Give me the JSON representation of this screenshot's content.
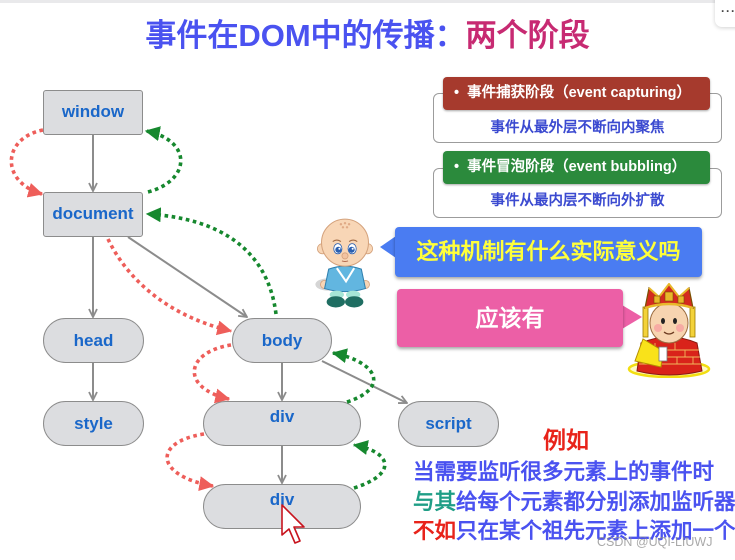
{
  "title": {
    "part1": "事件在DOM中的传播：",
    "part2": "两个阶段",
    "color1": "#4a52f0",
    "color2": "#c72a72"
  },
  "menu_button": {
    "icon": "more-icon",
    "label": "···"
  },
  "tree": {
    "nodes": {
      "window": "window",
      "document": "document",
      "head": "head",
      "body": "body",
      "style": "style",
      "div_outer": "div",
      "div_inner": "div",
      "script": "script"
    },
    "edges": [
      [
        "window",
        "document"
      ],
      [
        "document",
        "head"
      ],
      [
        "document",
        "body"
      ],
      [
        "head",
        "style"
      ],
      [
        "body",
        "div_outer"
      ],
      [
        "body",
        "script"
      ],
      [
        "div_outer",
        "div_inner"
      ]
    ],
    "capture_path": [
      "window",
      "document",
      "body",
      "div_outer",
      "div_inner"
    ],
    "bubble_path": [
      "div_inner",
      "div_outer",
      "body",
      "document",
      "window"
    ],
    "capture_color": "#ee5e5a",
    "bubble_color": "#16882e"
  },
  "phases": [
    {
      "label": "事件捕获阶段（event capturing）",
      "desc": "事件从最外层不断向内聚焦",
      "color": "#a63a2d"
    },
    {
      "label": "事件冒泡阶段（event bubbling）",
      "desc": "事件从最内层不断向外扩散",
      "color": "#2b8a3c"
    }
  ],
  "phase_bullet": "•",
  "phase_desc_color": "#3b4ad0",
  "dialog": {
    "question": "这种机制有什么实际意义吗",
    "answer": "应该有"
  },
  "example": {
    "heading": "例如",
    "heading_color": "#e8231a",
    "lines": [
      [
        {
          "text": "当需要监听很多元素上的事件时",
          "color": "#4a52f0"
        }
      ],
      [
        {
          "text": "与其",
          "color": "#1f9e86"
        },
        {
          "text": "给每个元素都分别添加监听器",
          "color": "#4a52f0"
        }
      ],
      [
        {
          "text": "不如",
          "color": "#e8231a"
        },
        {
          "text": "只在某个祖先元素上添加一个",
          "color": "#4a52f0"
        }
      ]
    ]
  },
  "watermark": "CSDN @UQI-LIUWJ"
}
